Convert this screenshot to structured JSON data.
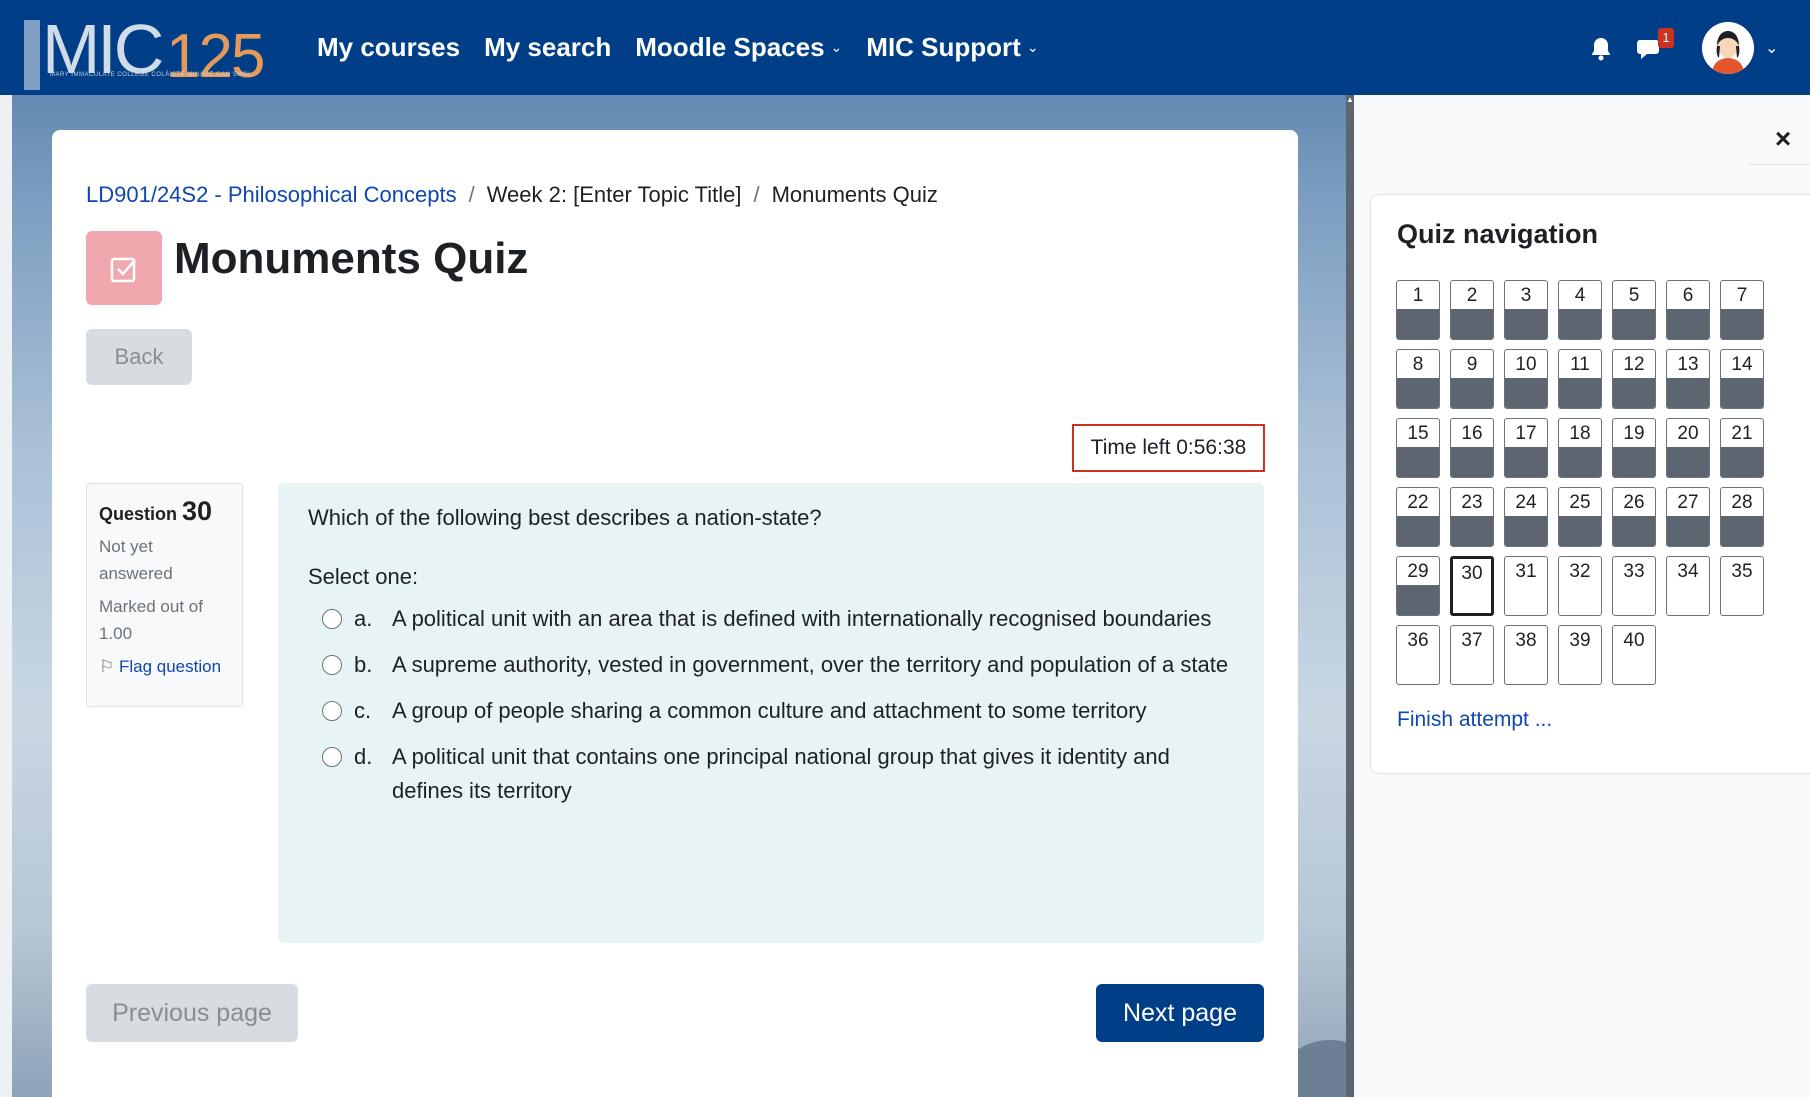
{
  "navbar": {
    "logo_text": "MIC",
    "logo_year": "125",
    "logo_tagline": "MARY IMMACULATE COLLEGE COLÁISTE MHUIRE GAN SMÁL",
    "links": [
      {
        "label": "My courses",
        "has_dropdown": false
      },
      {
        "label": "My search",
        "has_dropdown": false
      },
      {
        "label": "Moodle Spaces",
        "has_dropdown": true
      },
      {
        "label": "MIC Support",
        "has_dropdown": true
      }
    ],
    "notification_icon": "bell-icon",
    "message_icon": "chat-icon",
    "message_badge": "1"
  },
  "breadcrumb": {
    "course": "LD901/24S2 - Philosophical Concepts",
    "section": "Week 2: [Enter Topic Title]",
    "current": "Monuments Quiz",
    "separator": "/"
  },
  "page": {
    "title": "Monuments Quiz",
    "back_label": "Back",
    "timer": "Time left 0:56:38"
  },
  "question": {
    "label": "Question",
    "number": "30",
    "status_line1": "Not yet",
    "status_line2": "answered",
    "marked_line1": "Marked out of",
    "marked_line2": "1.00",
    "flag_label": "Flag question",
    "text": "Which of the following best describes a nation-state?",
    "prompt": "Select one:",
    "options": [
      {
        "letter": "a.",
        "text": "A political unit with an area that is defined with internationally recognised boundaries"
      },
      {
        "letter": "b.",
        "text": "A supreme authority, vested in government, over the territory and population of a state"
      },
      {
        "letter": "c.",
        "text": "A group of people sharing a common culture and attachment to some territory"
      },
      {
        "letter": "d.",
        "text": "A political unit that contains one principal national group that gives it identity and defines its territory"
      }
    ]
  },
  "footer": {
    "prev_label": "Previous page",
    "next_label": "Next page"
  },
  "quiz_nav": {
    "close_symbol": "×",
    "title": "Quiz navigation",
    "questions": [
      "1",
      "2",
      "3",
      "4",
      "5",
      "6",
      "7",
      "8",
      "9",
      "10",
      "11",
      "12",
      "13",
      "14",
      "15",
      "16",
      "17",
      "18",
      "19",
      "20",
      "21",
      "22",
      "23",
      "24",
      "25",
      "26",
      "27",
      "28",
      "29",
      "30",
      "31",
      "32",
      "33",
      "34",
      "35",
      "36",
      "37",
      "38",
      "39",
      "40"
    ],
    "answered_count": 29,
    "current": "30",
    "finish_label": "Finish attempt ..."
  },
  "colors": {
    "navbar": "#003f87",
    "link": "#0f47ad",
    "timer_border": "#ca3120",
    "question_bg": "#e7f3f5",
    "answered_fill": "#5d6670",
    "quiz_icon_bg": "#f0a8ae"
  }
}
